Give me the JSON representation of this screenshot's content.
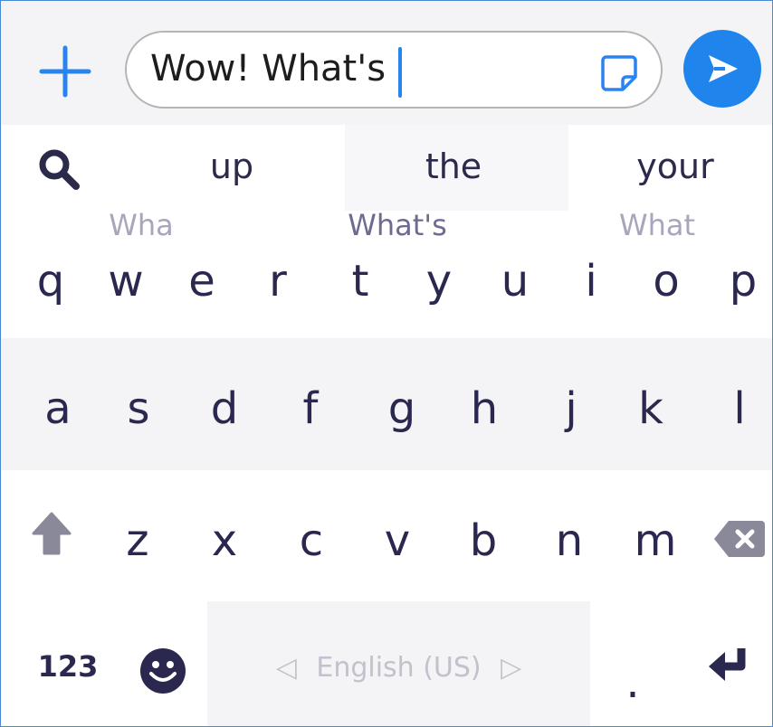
{
  "input": {
    "value": "Wow! What's"
  },
  "suggestions": [
    "up",
    "the",
    "your"
  ],
  "predictions": [
    "Wha",
    "What's",
    "What"
  ],
  "keyboard": {
    "row1": [
      "q",
      "w",
      "e",
      "r",
      "t",
      "y",
      "u",
      "i",
      "o",
      "p"
    ],
    "row2": [
      "a",
      "s",
      "d",
      "f",
      "g",
      "h",
      "j",
      "k",
      "l"
    ],
    "row3": [
      "z",
      "x",
      "c",
      "v",
      "b",
      "n",
      "m"
    ],
    "numbers_label": "123",
    "space_label": "English (US)",
    "space_left_arrow": "◁",
    "space_right_arrow": "▷",
    "period_label": "."
  },
  "colors": {
    "accent": "#1f84ec",
    "key_text": "#2b2850",
    "bar_bg": "#f4f4f6",
    "prediction": "#a8a6bd"
  },
  "icons": [
    "plus-icon",
    "sticker-icon",
    "send-icon",
    "search-icon",
    "shift-icon",
    "backspace-icon",
    "emoji-icon",
    "return-icon"
  ]
}
